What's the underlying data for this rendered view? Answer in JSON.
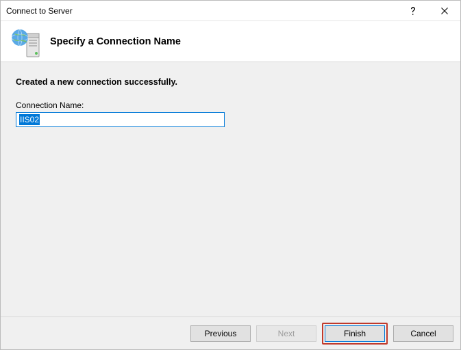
{
  "window": {
    "title": "Connect to Server"
  },
  "header": {
    "heading": "Specify a Connection Name"
  },
  "body": {
    "status": "Created a new connection successfully.",
    "connection_name_label": "Connection Name:",
    "connection_name_value": "IIS02"
  },
  "buttons": {
    "previous": "Previous",
    "next": "Next",
    "finish": "Finish",
    "cancel": "Cancel"
  }
}
